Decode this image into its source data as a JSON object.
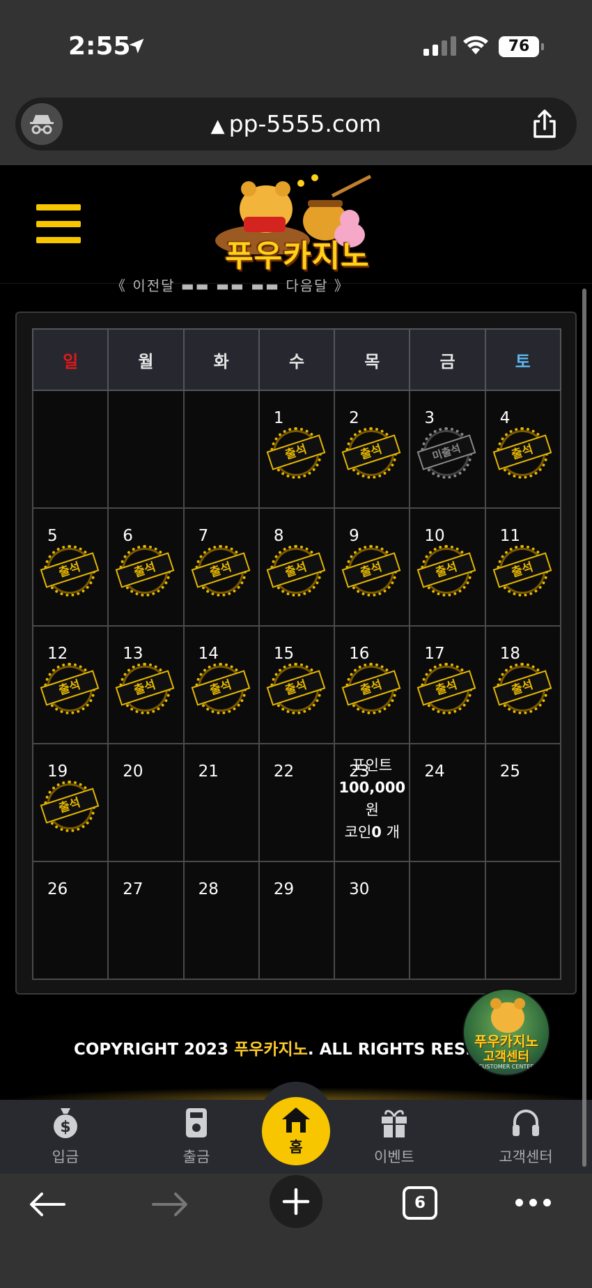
{
  "status_bar": {
    "time": "2:55",
    "battery": "76"
  },
  "browser": {
    "url": "pp-5555.com",
    "tab_count": "6"
  },
  "site": {
    "logo_text": "푸우카지노",
    "cut_text": "《 이전달   ▬▬ ▬▬ ▬▬   다음달 》"
  },
  "calendar": {
    "weekdays": [
      "일",
      "월",
      "화",
      "수",
      "목",
      "금",
      "토"
    ],
    "stamp_attended": "출석",
    "stamp_absent": "미출석",
    "days": {
      "d1": "1",
      "d2": "2",
      "d3": "3",
      "d4": "4",
      "d5": "5",
      "d6": "6",
      "d7": "7",
      "d8": "8",
      "d9": "9",
      "d10": "10",
      "d11": "11",
      "d12": "12",
      "d13": "13",
      "d14": "14",
      "d15": "15",
      "d16": "16",
      "d17": "17",
      "d18": "18",
      "d19": "19",
      "d20": "20",
      "d21": "21",
      "d22": "22",
      "d23": "23",
      "d24": "24",
      "d25": "25",
      "d26": "26",
      "d27": "27",
      "d28": "28",
      "d29": "29",
      "d30": "30"
    },
    "points": {
      "label": "포인트",
      "amount": "100,000",
      "unit": "원",
      "coin_label": "코인",
      "coin_count": "0",
      "coin_unit": "개"
    }
  },
  "footer": {
    "copyright_prefix": "COPYRIGHT 2023 ",
    "brand": "푸우카지노",
    "copyright_suffix": ". ALL RIGHTS RESE",
    "cs_badge_line1": "푸우카지노",
    "cs_badge_line2": "고객센터",
    "cs_badge_line3": "CUSTOMER CENTER"
  },
  "bottom_nav": {
    "deposit": "입금",
    "withdraw": "출금",
    "home": "홈",
    "event": "이벤트",
    "support": "고객센터"
  },
  "colors": {
    "accent": "#f7c600",
    "sunday": "#e01a1a",
    "saturday": "#5db8f0"
  }
}
